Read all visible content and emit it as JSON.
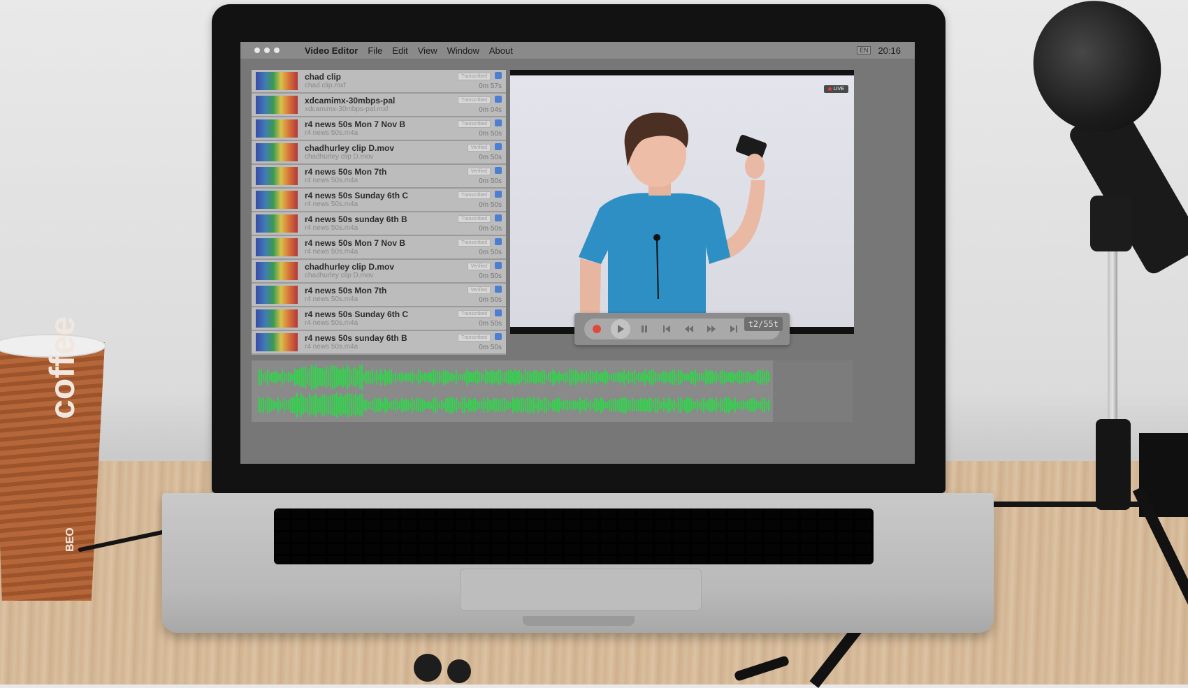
{
  "menubar": {
    "app_name": "Video Editor",
    "items": [
      "File",
      "Edit",
      "View",
      "Window",
      "About"
    ],
    "lang": "EN",
    "clock": "20:16"
  },
  "files": [
    {
      "title": "chad clip",
      "file": "chad clip.mxf",
      "status": "Transcribed",
      "duration": "0m 57s"
    },
    {
      "title": "xdcamimx-30mbps-pal",
      "file": "xdcamimx-30mbps-pal.mxf",
      "status": "Transcribed",
      "duration": "0m 04s"
    },
    {
      "title": "r4 news 50s Mon 7 Nov B",
      "file": "r4 news 50s.m4a",
      "status": "Transcribed",
      "duration": "0m 50s"
    },
    {
      "title": "chadhurley clip D.mov",
      "file": "chadhurley clip D.mov",
      "status": "Verified",
      "duration": "0m 50s"
    },
    {
      "title": "r4 news 50s Mon 7th",
      "file": "r4 news 50s.m4a",
      "status": "Verified",
      "duration": "0m 50s"
    },
    {
      "title": "r4 news 50s Sunday 6th C",
      "file": "r4 news 50s.m4a",
      "status": "Transcribed",
      "duration": "0m 50s"
    },
    {
      "title": "r4 news 50s sunday 6th B",
      "file": "r4 news 50s.m4a",
      "status": "Transcribed",
      "duration": "0m 50s"
    },
    {
      "title": "r4 news 50s Mon 7 Nov B",
      "file": "r4 news 50s.m4a",
      "status": "Transcribed",
      "duration": "0m 50s"
    },
    {
      "title": "chadhurley clip D.mov",
      "file": "chadhurley clip D.mov",
      "status": "Verified",
      "duration": "0m 50s"
    },
    {
      "title": "r4 news 50s Mon 7th",
      "file": "r4 news 50s.m4a",
      "status": "Verified",
      "duration": "0m 50s"
    },
    {
      "title": "r4 news 50s Sunday 6th C",
      "file": "r4 news 50s.m4a",
      "status": "Transcribed",
      "duration": "0m 50s"
    },
    {
      "title": "r4 news 50s sunday 6th B",
      "file": "r4 news 50s.m4a",
      "status": "Transcribed",
      "duration": "0m 50s"
    }
  ],
  "preview": {
    "live_label": "LIVE"
  },
  "transport": {
    "timecode": "t2/55t",
    "icons": [
      "record-icon",
      "play-icon",
      "pause-icon",
      "skip-back-icon",
      "rewind-icon",
      "fast-forward-icon",
      "skip-forward-icon"
    ]
  },
  "cup": {
    "brand": "coffee",
    "brand_prefix": "BEO"
  },
  "colors": {
    "menubar": "#8a8a8a",
    "row_bg": "#bcbcbc",
    "accent_check": "#4b7fd1",
    "record_red": "#e0483e",
    "waveform_green": "#2fd64a",
    "shirt_blue": "#2e8fc4"
  }
}
